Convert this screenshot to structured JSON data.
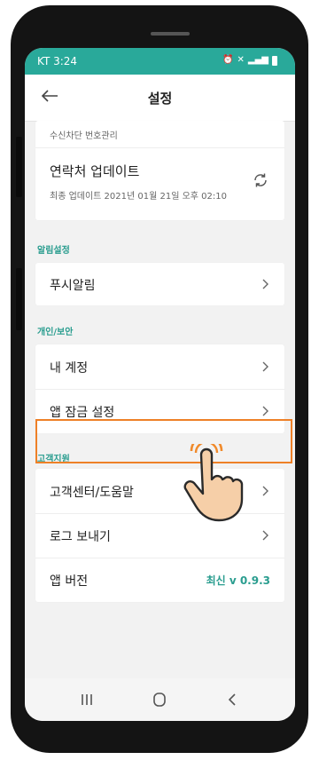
{
  "statusbar": {
    "carrier_time": "KT 3:24"
  },
  "header": {
    "title": "설정"
  },
  "sections": {
    "top_card": {
      "partial_label": "수신차단 번호관리",
      "contacts_update_label": "연락처 업데이트",
      "contacts_update_sub": "최종 업데이트 2021년 01월 21일 오후 02:10"
    },
    "notifications": {
      "title": "알림설정",
      "push_label": "푸시알림"
    },
    "privacy": {
      "title": "개인/보안",
      "account_label": "내 계정",
      "app_lock_label": "앱 잠금 설정"
    },
    "support": {
      "title": "고객지원",
      "help_label": "고객센터/도움말",
      "send_log_label": "로그 보내기",
      "version_label": "앱 버전",
      "version_value": "최신 v 0.9.3"
    }
  },
  "colors": {
    "accent": "#2a9d8f",
    "statusbar": "#29a99a",
    "highlight": "#ee8027"
  }
}
